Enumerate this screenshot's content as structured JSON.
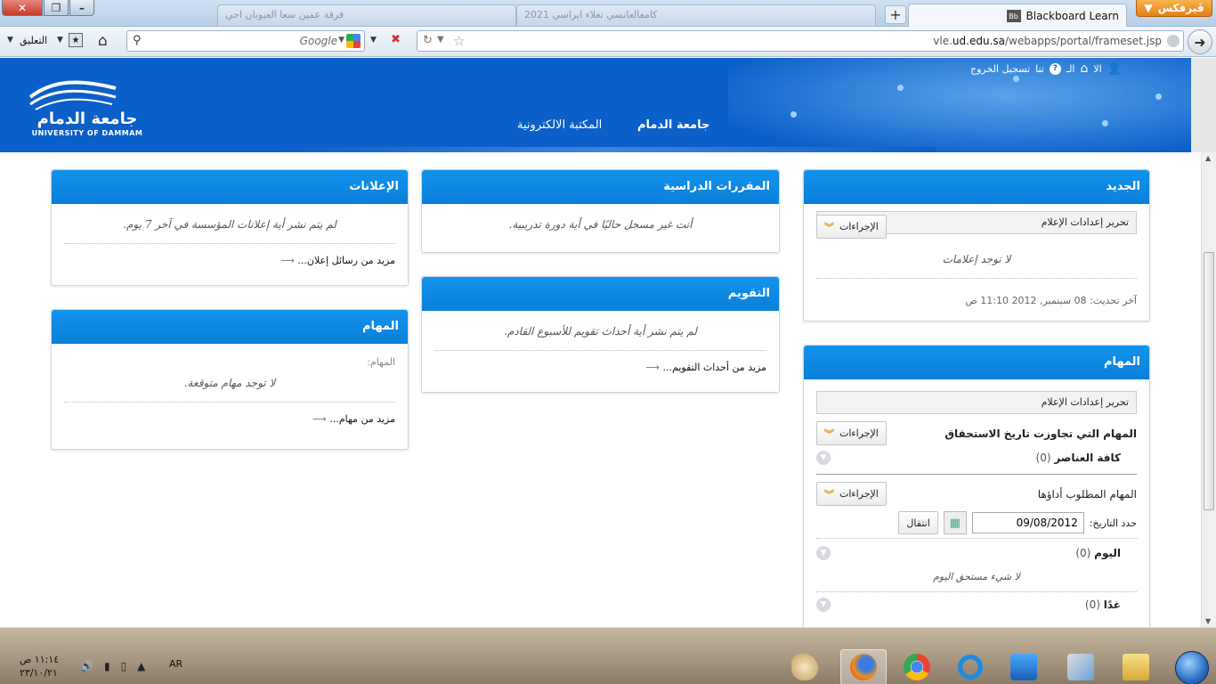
{
  "browser": {
    "firefox_menu": "فَيرفكس",
    "active_tab": "Blackboard Learn",
    "bg_tabs": [
      "فرقة عمين سعا العيوبان احي",
      "كامعالعانسي تعلاء ابراسي 2021"
    ],
    "url_host_prefix": "vle.",
    "url_host": "ud.edu.sa",
    "url_path": "/webapps/portal/frameset.jsp",
    "search_placeholder": "Google",
    "comment_label": "التعليق"
  },
  "header": {
    "logo_arabic": "جامعة الدمام",
    "logo_english": "UNIVERSITY OF DAMMAM",
    "nav": {
      "dammam": "جامعة الدمام",
      "library": "المكتبة الالكترونية"
    },
    "logout": "تسجيل الخروج",
    "link_tna": "تنا",
    "link_al": "الـ",
    "link_la": "الا"
  },
  "modules": {
    "announcements": {
      "title": "الإعلانات",
      "empty": "لم يتم نشر أية إعلانات المؤسسة في آخر 7 يوم.",
      "more": "مزيد من رسائل إعلان..."
    },
    "courses": {
      "title": "المقررات الدراسية",
      "empty": "أنت غير مسجل حاليًا في أية دورة تدريبية."
    },
    "new": {
      "title": "الجديد",
      "edit": "تحرير إعدادات الإعلام",
      "actions": "الإجراءات",
      "empty": "لا توجد إعلامات",
      "updated_label": "آخر تحديث:",
      "updated_value": "08 سبتمبر, 2012 11:10 ص"
    },
    "tasks_left": {
      "title": "المهام",
      "label": "المهام:",
      "empty": "لا توجد مهام متوقعة.",
      "more": "مزيد من مهام..."
    },
    "calendar": {
      "title": "التقويم",
      "empty": "لم يتم نشر أية أحداث تقويم للأسبوع القادم.",
      "more": "مزيد من أحداث التقويم..."
    },
    "tasks_right": {
      "title": "المهام",
      "edit": "تحرير إعدادات الإعلام",
      "overdue_title": "المهام التي تجاوزت تاريخ الاستحقاق",
      "actions": "الإجراءات",
      "all_items": "كافة العناصر",
      "all_count": "(0)",
      "due_title": "المهام المطلوب أداؤها",
      "date_label": "حدد التاريخ:",
      "date_value": "09/08/2012",
      "go": "انتقال",
      "today": "اليوم",
      "today_count": "(0)",
      "nothing_today": "لا شيء مستحق اليوم",
      "tomorrow": "غدًا",
      "tomorrow_count": "(0)"
    }
  },
  "taskbar": {
    "time": "١١:١٤ ص",
    "date": "٢٣/١٠/٢١",
    "lang": "AR"
  },
  "colors": {
    "brand_blue": "#0b5fc8",
    "module_header": "#0d86e0",
    "action_chevron": "#e59a1a"
  }
}
